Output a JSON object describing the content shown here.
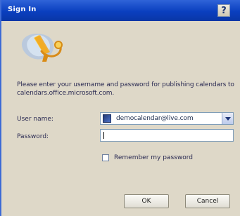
{
  "window": {
    "title": "Sign In",
    "help_icon": "help-icon",
    "help_label": "?"
  },
  "logo": {
    "icon": "sign-in-logo-icon"
  },
  "prompt": {
    "text": "Please enter your username and password for publishing calendars to calendars.office.microsoft.com."
  },
  "fields": {
    "username_label": "User name:",
    "username_value": "democalendar@live.com",
    "username_icon": "user-account-icon",
    "password_label": "Password:",
    "password_value": ""
  },
  "remember": {
    "label": "Remember my password",
    "checked": false
  },
  "buttons": {
    "ok": "OK",
    "cancel": "Cancel"
  },
  "colors": {
    "titlebar": "#0a3fbf",
    "dialog_background": "#ded8c8",
    "field_border": "#7f9db9"
  }
}
